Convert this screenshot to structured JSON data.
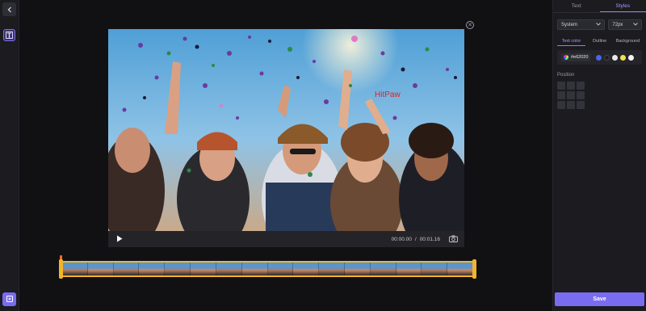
{
  "rail": {
    "back_icon": "chevron-left-icon",
    "text_tool_icon": "text-tool-icon",
    "export_icon": "export-icon"
  },
  "overlay": {
    "text": "HitPaw",
    "color": "#e62020"
  },
  "player": {
    "current_time": "00:00.00",
    "separator": "/",
    "total_time": "00:01.16"
  },
  "panel": {
    "tabs": [
      {
        "label": "Text"
      },
      {
        "label": "Styles"
      }
    ],
    "font_select": "System",
    "size_select": "72px",
    "subtabs": [
      {
        "label": "Text color"
      },
      {
        "label": "Outline"
      },
      {
        "label": "Background"
      }
    ],
    "hex_value": "#e62020",
    "swatches": [
      "#4a66e8",
      "#1e1e1e",
      "#e8e8e8",
      "#f0e24a",
      "#f4f4f4"
    ],
    "position_label": "Position",
    "save_label": "Save"
  },
  "colors": {
    "accent": "#7a6cf0",
    "timeline_border": "#f3b52a"
  }
}
